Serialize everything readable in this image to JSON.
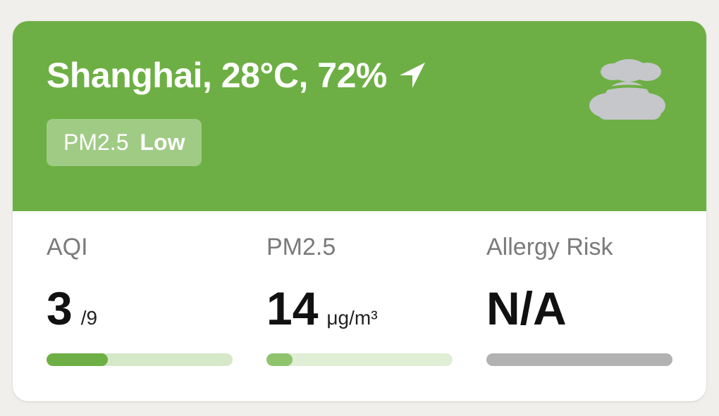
{
  "header": {
    "title": "Shanghai, 28°C, 72%",
    "location_icon": "navigation-arrow-icon",
    "weather_icon": "cloudy-icon",
    "badge": {
      "label": "PM2.5",
      "level": "Low"
    }
  },
  "metrics": [
    {
      "label": "AQI",
      "value": "3",
      "unit": "/9",
      "progress": 0.33,
      "fill_color": "#6daf44",
      "track_color": "#d5e8c7"
    },
    {
      "label": "PM2.5",
      "value": "14",
      "unit": "μg/m³",
      "progress": 0.14,
      "fill_color": "#8fc46c",
      "track_color": "#e0eed5"
    },
    {
      "label": "Allergy Risk",
      "value": "N/A",
      "unit": "",
      "progress": 0,
      "fill_color": "#b2b2b2",
      "track_color": "#b2b2b2"
    }
  ],
  "colors": {
    "header_background": "#6daf44",
    "card_background": "#ffffff",
    "page_background": "#f0efeb",
    "cloud": "#c5c7cb"
  }
}
